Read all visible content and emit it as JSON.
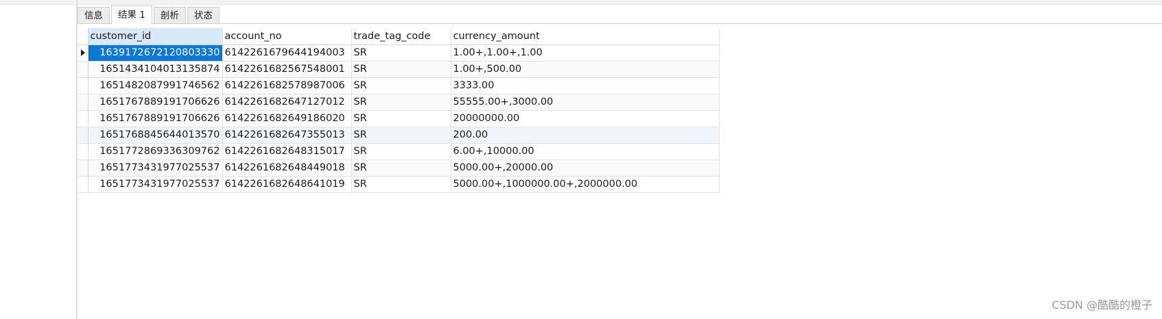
{
  "tabs": [
    {
      "label": "信息"
    },
    {
      "label": "结果 1"
    },
    {
      "label": "剖析"
    },
    {
      "label": "状态"
    }
  ],
  "grid": {
    "columns": [
      "customer_id",
      "account_no",
      "trade_tag_code",
      "currency_amount"
    ],
    "rows": [
      [
        "1639172672120803330",
        "6142261679644194003",
        "SR",
        "1.00+,1.00+,1.00"
      ],
      [
        "1651434104013135874",
        "6142261682567548001",
        "SR",
        "1.00+,500.00"
      ],
      [
        "1651482087991746562",
        "6142261682578987006",
        "SR",
        "3333.00"
      ],
      [
        "1651767889191706626",
        "6142261682647127012",
        "SR",
        "55555.00+,3000.00"
      ],
      [
        "1651767889191706626",
        "6142261682649186020",
        "SR",
        "20000000.00"
      ],
      [
        "1651768845644013570",
        "6142261682647355013",
        "SR",
        "200.00"
      ],
      [
        "1651772869336309762",
        "6142261682648315017",
        "SR",
        "6.00+,10000.00"
      ],
      [
        "1651773431977025537",
        "6142261682648449018",
        "SR",
        "5000.00+,20000.00"
      ],
      [
        "1651773431977025537",
        "6142261682648641019",
        "SR",
        "5000.00+,1000000.00+,2000000.00"
      ]
    ]
  },
  "watermark": "CSDN @酷酷的橙子"
}
